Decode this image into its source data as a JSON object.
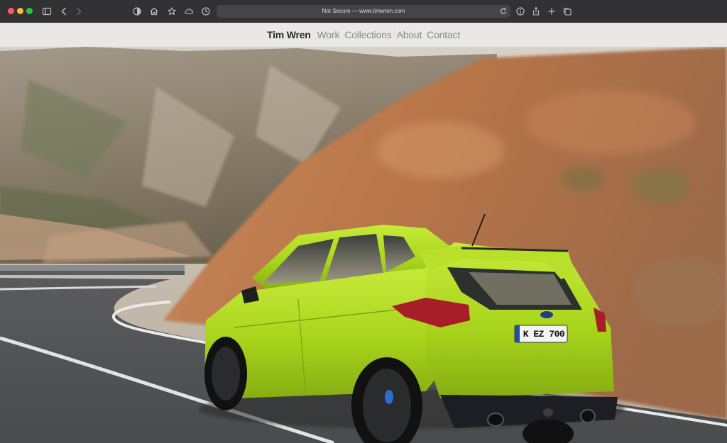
{
  "browser": {
    "address_text": "Not Secure — www.timwren.com",
    "icons": [
      "sidebar-icon",
      "back-icon",
      "forward-icon",
      "shield-icon",
      "home-icon",
      "star-icon",
      "cloud-icon",
      "history-icon",
      "reload-icon",
      "info-icon",
      "share-icon",
      "plus-icon",
      "tabs-icon"
    ]
  },
  "site": {
    "nav": {
      "brand": "Tim Wren",
      "links": [
        "Work",
        "Collections",
        "About",
        "Contact"
      ]
    },
    "hero": {
      "plate_text": "K EZ 700",
      "car_color": "#a8d41c"
    }
  }
}
